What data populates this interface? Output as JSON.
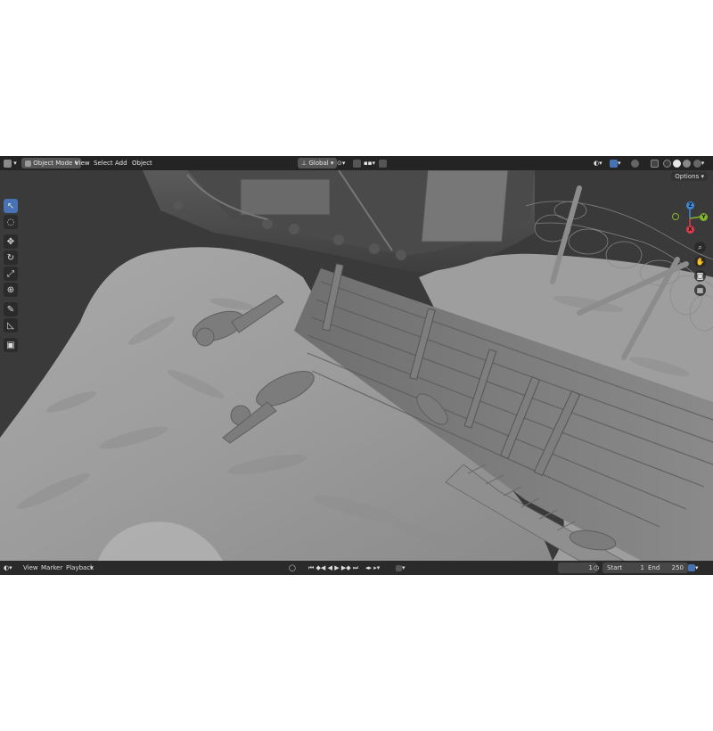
{
  "header": {
    "mode": "Object Mode",
    "menus": [
      "View",
      "Select",
      "Add",
      "Object"
    ],
    "transform_orientation": "Global",
    "options_label": "Options"
  },
  "toolbar": {
    "tools": [
      "select-box",
      "cursor",
      "move",
      "rotate",
      "scale",
      "transform",
      "annotate",
      "measure",
      "add-cube"
    ],
    "active_tool": "select-box"
  },
  "gizmo": {
    "axes": [
      "Z",
      "Y",
      "X"
    ]
  },
  "timeline": {
    "menus": [
      "View",
      "Marker",
      "Playback"
    ],
    "current_frame": "1",
    "start_label": "Start",
    "start": "1",
    "end_label": "End",
    "end": "250"
  },
  "colors": {
    "accent": "#4772b3",
    "header_bg": "#242424",
    "viewport_bg": "#3a3a3a",
    "axis_x": "#e03a4e",
    "axis_y": "#83b52c",
    "axis_z": "#3d88d9"
  }
}
